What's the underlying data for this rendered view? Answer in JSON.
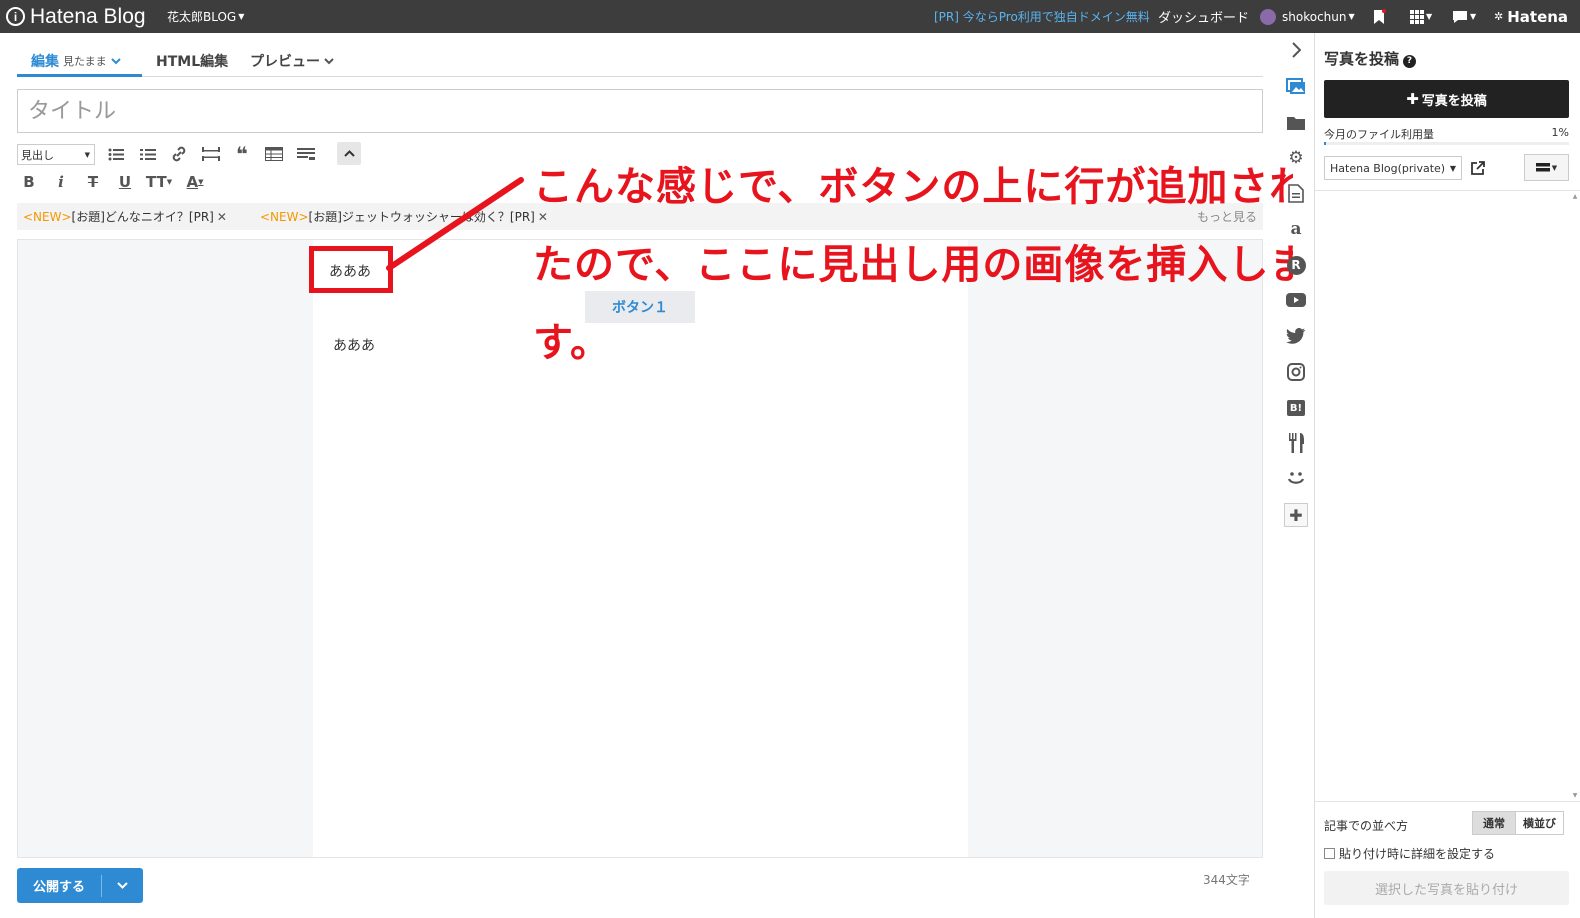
{
  "topbar": {
    "logo": "Hatena Blog",
    "blog_name": "花太郎BLOG",
    "pr_link": "[PR] 今ならPro利用で独自ドメイン無料",
    "dashboard": "ダッシュボード",
    "username": "shokochun",
    "hatena": "Hatena"
  },
  "tabs": {
    "edit": "編集",
    "edit_mode": "見たまま",
    "html": "HTML編集",
    "preview": "プレビュー"
  },
  "title_placeholder": "タイトル",
  "toolbar": {
    "heading": "見出し"
  },
  "topics": [
    {
      "new": "<NEW>",
      "text": "[お題]どんなニオイ？[PR]"
    },
    {
      "new": "<NEW>",
      "text": "[お題]ジェットウォッシャーは効く？[PR]"
    }
  ],
  "topics_more": "もっと見る",
  "editor": {
    "line1": "あああ",
    "button": "ボタン１",
    "line2": "あああ"
  },
  "annotation": {
    "line1": "こんな感じで、ボタンの上に行が追加され",
    "line2": "たので、ここに見出し用の画像を挿入しま",
    "line3": "す。",
    "color": "#e8141d"
  },
  "footer": {
    "publish": "公開する",
    "char_count": "344文字"
  },
  "right_panel": {
    "title": "写真を投稿",
    "upload": "写真を投稿",
    "usage_label": "今月のファイル利用量",
    "usage_pct": "1%",
    "usage_value": 0.01,
    "album": "Hatena Blog(private)",
    "arrange_label": "記事での並べ方",
    "arrange_normal": "通常",
    "arrange_side": "横並び",
    "detail_checkbox": "貼り付け時に詳細を設定する",
    "paste": "選択した写真を貼り付け"
  },
  "colors": {
    "accent": "#2e8bd3",
    "topbar": "#3d3d3d",
    "annotation_red": "#e8141d",
    "new_badge": "#f39800"
  }
}
